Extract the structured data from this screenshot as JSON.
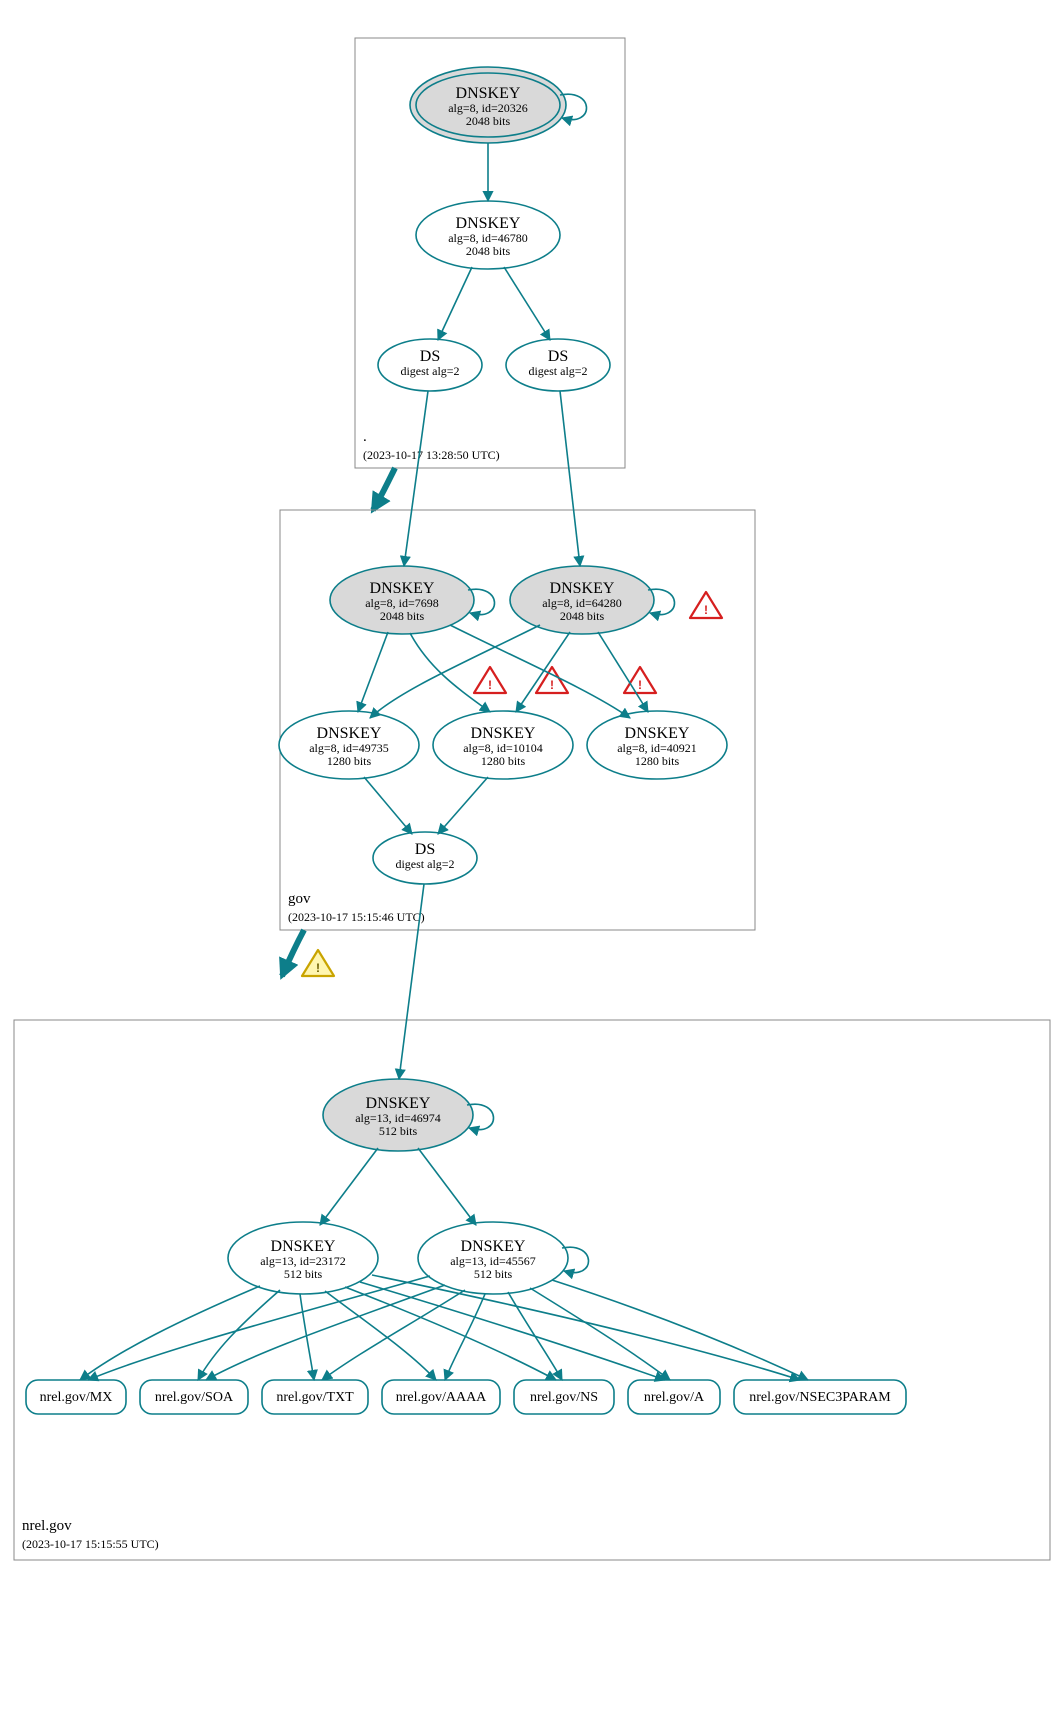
{
  "zones": {
    "root": {
      "name": ".",
      "timestamp": "(2023-10-17 13:28:50 UTC)"
    },
    "gov": {
      "name": "gov",
      "timestamp": "(2023-10-17 15:15:46 UTC)"
    },
    "nrel": {
      "name": "nrel.gov",
      "timestamp": "(2023-10-17 15:15:55 UTC)"
    }
  },
  "nodes": {
    "root_ksk": {
      "title": "DNSKEY",
      "detail": "alg=8, id=20326",
      "bits": "2048 bits"
    },
    "root_zsk": {
      "title": "DNSKEY",
      "detail": "alg=8, id=46780",
      "bits": "2048 bits"
    },
    "root_ds1": {
      "title": "DS",
      "detail": "digest alg=2"
    },
    "root_ds2": {
      "title": "DS",
      "detail": "digest alg=2"
    },
    "gov_ksk1": {
      "title": "DNSKEY",
      "detail": "alg=8, id=7698",
      "bits": "2048 bits"
    },
    "gov_ksk2": {
      "title": "DNSKEY",
      "detail": "alg=8, id=64280",
      "bits": "2048 bits"
    },
    "gov_zsk1": {
      "title": "DNSKEY",
      "detail": "alg=8, id=49735",
      "bits": "1280 bits"
    },
    "gov_zsk2": {
      "title": "DNSKEY",
      "detail": "alg=8, id=10104",
      "bits": "1280 bits"
    },
    "gov_zsk3": {
      "title": "DNSKEY",
      "detail": "alg=8, id=40921",
      "bits": "1280 bits"
    },
    "gov_ds": {
      "title": "DS",
      "detail": "digest alg=2"
    },
    "nrel_ksk": {
      "title": "DNSKEY",
      "detail": "alg=13, id=46974",
      "bits": "512 bits"
    },
    "nrel_zsk1": {
      "title": "DNSKEY",
      "detail": "alg=13, id=23172",
      "bits": "512 bits"
    },
    "nrel_zsk2": {
      "title": "DNSKEY",
      "detail": "alg=13, id=45567",
      "bits": "512 bits"
    }
  },
  "rr": {
    "mx": "nrel.gov/MX",
    "soa": "nrel.gov/SOA",
    "txt": "nrel.gov/TXT",
    "aaaa": "nrel.gov/AAAA",
    "ns": "nrel.gov/NS",
    "a": "nrel.gov/A",
    "nsec3": "nrel.gov/NSEC3PARAM"
  }
}
